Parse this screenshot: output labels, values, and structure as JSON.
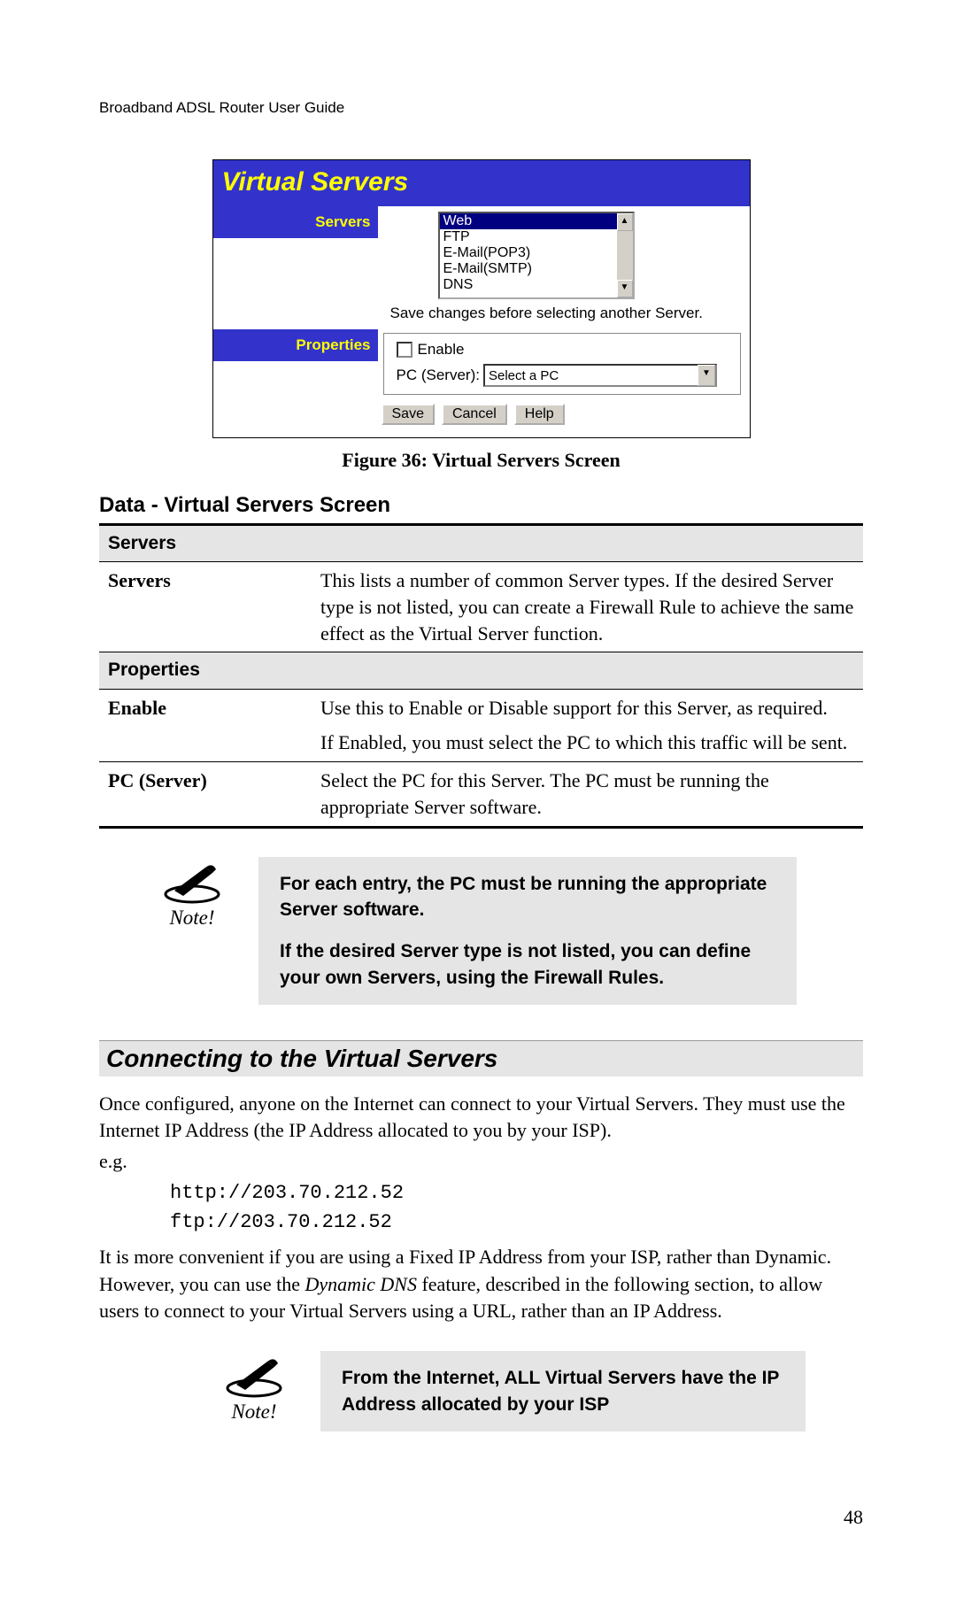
{
  "header": "Broadband ADSL Router User Guide",
  "page_number": "48",
  "figure": {
    "title": "Virtual Servers",
    "labels": {
      "servers": "Servers",
      "properties": "Properties"
    },
    "listbox_items": [
      "Web",
      "FTP",
      "E-Mail(POP3)",
      "E-Mail(SMTP)",
      "DNS"
    ],
    "listbox_selected": "Web",
    "hint": "Save changes before selecting another Server.",
    "enable_label": "Enable",
    "pc_label": "PC (Server):",
    "pc_dropdown": "Select a PC",
    "buttons": {
      "save": "Save",
      "cancel": "Cancel",
      "help": "Help"
    }
  },
  "caption": "Figure 36: Virtual Servers Screen",
  "section_title": "Data - Virtual Servers Screen",
  "table": {
    "section1": "Servers",
    "row1_label": "Servers",
    "row1_desc": "This lists a number of common Server types. If the desired Server type is not listed, you can create a Firewall Rule to achieve the same effect as the Virtual Server function.",
    "section2": "Properties",
    "row2_label": "Enable",
    "row2_desc_p1": "Use this to Enable or Disable support for this Server, as required.",
    "row2_desc_p2": "If Enabled, you must select the PC to which this traffic will be sent.",
    "row3_label": "PC (Server)",
    "row3_desc": "Select the PC for this Server. The PC must be running the appropriate Server software."
  },
  "note1": {
    "label": "Note!",
    "p1": "For each entry, the PC must be running the appropriate Server software.",
    "p2": "If the desired Server type is not listed, you can define your own Servers, using the Firewall Rules."
  },
  "section2_title": "Connecting to the Virtual Servers",
  "para1": "Once configured, anyone on the Internet can connect to your Virtual Servers. They must use the Internet IP Address (the IP Address allocated to you by your ISP).",
  "para_eg": "e.g.",
  "code1": "http://203.70.212.52",
  "code2": "ftp://203.70.212.52",
  "para2_pre": "It is more convenient if you are using a Fixed IP Address from your ISP, rather than Dynamic. However, you can use the ",
  "para2_em": "Dynamic DNS",
  "para2_post": " feature, described in the following section, to allow users to connect to your Virtual Servers using a URL, rather than an IP Address.",
  "note2": {
    "label": "Note!",
    "text": "From the Internet, ALL Virtual Servers have the IP Address allocated by your ISP"
  }
}
